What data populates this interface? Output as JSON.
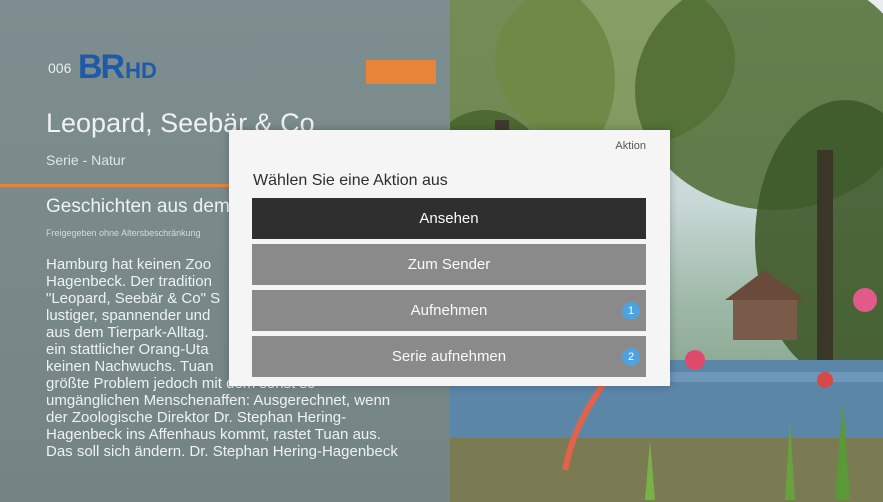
{
  "channel": {
    "number": "006",
    "logo_br": "BR",
    "logo_hd": "HD"
  },
  "program": {
    "title": "Leopard, Seebär & Co",
    "genre": "Serie - Natur",
    "episode_title": "Geschichten aus dem",
    "rating": "Freigegeben ohne Altersbeschränkung",
    "description_lines": [
      "Hamburg hat keinen Zoo",
      "Hagenbeck. Der tradition",
      "\"Leopard, Seebär & Co\" S",
      "lustiger, spannender und",
      "aus dem Tierpark-Alltag.",
      "ein stattlicher Orang-Uta",
      "keinen Nachwuchs. Tuan",
      "größte Problem jedoch mit dem sonst so",
      "umgänglichen Menschenaffen: Ausgerechnet, wenn",
      "der Zoologische Direktor Dr. Stephan Hering-",
      "Hagenbeck ins Affenhaus kommt, rastet Tuan aus.",
      "Das soll sich ändern. Dr. Stephan Hering-Hagenbeck"
    ]
  },
  "dialog": {
    "label": "Aktion",
    "prompt": "Wählen Sie eine Aktion aus",
    "buttons": [
      {
        "label": "Ansehen",
        "badge": ""
      },
      {
        "label": "Zum Sender",
        "badge": ""
      },
      {
        "label": "Aufnehmen",
        "badge": "1"
      },
      {
        "label": "Serie aufnehmen",
        "badge": "2"
      }
    ]
  },
  "colors": {
    "accent_orange": "#e3853e",
    "selected_button": "#2f2f2f",
    "button": "#8a8a8a",
    "badge_blue": "#4ea2e0",
    "br_blue": "#1e5aa8"
  }
}
